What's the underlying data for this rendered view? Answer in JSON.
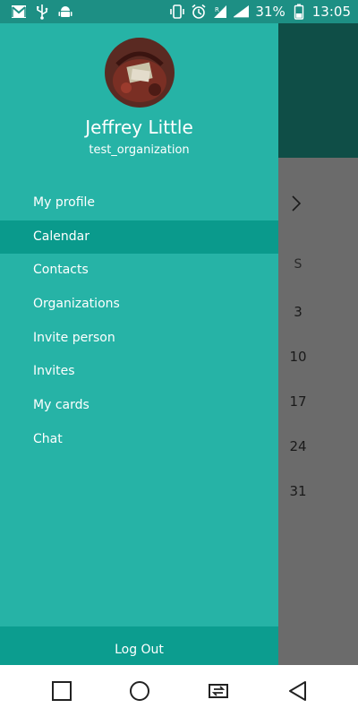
{
  "status_bar": {
    "left_icons": [
      "gmail-icon",
      "usb-icon",
      "android-debug-icon"
    ],
    "right_icons": [
      "vibrate-icon",
      "alarm-icon",
      "signal-icon",
      "signal-full-icon",
      "battery-icon"
    ],
    "battery_percent": "31%",
    "time": "13:05"
  },
  "drawer": {
    "user": {
      "name": "Jeffrey Little",
      "organization": "test_organization"
    },
    "menu_items": [
      {
        "label": "My profile",
        "active": false
      },
      {
        "label": "Calendar",
        "active": true
      },
      {
        "label": "Contacts",
        "active": false
      },
      {
        "label": "Organizations",
        "active": false
      },
      {
        "label": "Invite person",
        "active": false
      },
      {
        "label": "Invites",
        "active": false
      },
      {
        "label": "My cards",
        "active": false
      },
      {
        "label": "Chat",
        "active": false
      }
    ],
    "logout_label": "Log Out"
  },
  "background_calendar": {
    "day_header": "S",
    "dates": [
      "3",
      "10",
      "17",
      "24",
      "31"
    ]
  },
  "nav_bar": {
    "buttons": [
      "recents-square-icon",
      "home-circle-icon",
      "switch-apps-icon",
      "back-triangle-icon"
    ]
  },
  "colors": {
    "drawer": "#26b3a6",
    "active_item": "#0a9a8c",
    "status_bar": "#1d8f84",
    "toolbar_behind": "#0f4e47",
    "scrim_content": "#6b6b6b"
  }
}
